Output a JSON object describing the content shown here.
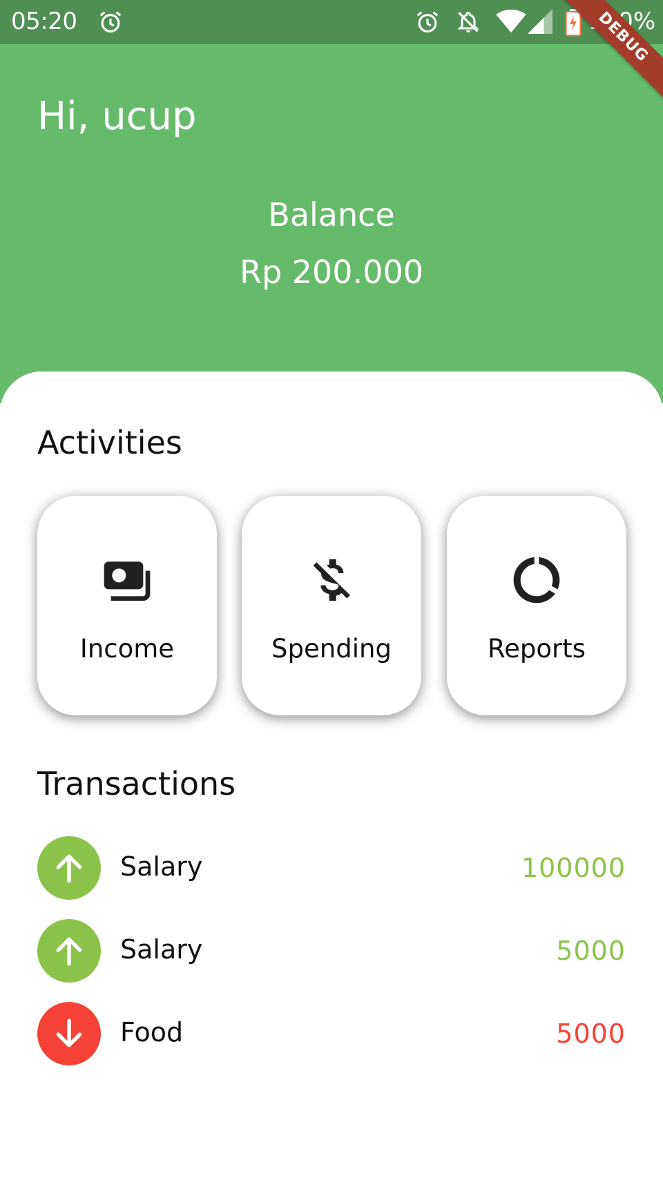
{
  "status_bar": {
    "time": "05:20",
    "battery_percent": "100%",
    "icons": [
      "alarm-icon",
      "alarm-icon",
      "notifications-off-icon",
      "wifi-icon",
      "signal-icon",
      "battery-charging-icon"
    ]
  },
  "debug_banner": "DEBUG",
  "header": {
    "greeting": "Hi, ucup",
    "balance_label": "Balance",
    "balance_amount": "Rp 200.000",
    "background_color": "#66bb6a"
  },
  "activities": {
    "title": "Activities",
    "items": [
      {
        "label": "Income",
        "icon": "money-icon"
      },
      {
        "label": "Spending",
        "icon": "money-off-icon"
      },
      {
        "label": "Reports",
        "icon": "donut-chart-icon"
      }
    ]
  },
  "transactions": {
    "title": "Transactions",
    "items": [
      {
        "name": "Salary",
        "amount": "100000",
        "direction": "income",
        "icon": "arrow-up-icon",
        "color": "#8bc34a"
      },
      {
        "name": "Salary",
        "amount": "5000",
        "direction": "income",
        "icon": "arrow-up-icon",
        "color": "#8bc34a"
      },
      {
        "name": "Food",
        "amount": "5000",
        "direction": "expense",
        "icon": "arrow-down-icon",
        "color": "#f44336"
      }
    ]
  }
}
